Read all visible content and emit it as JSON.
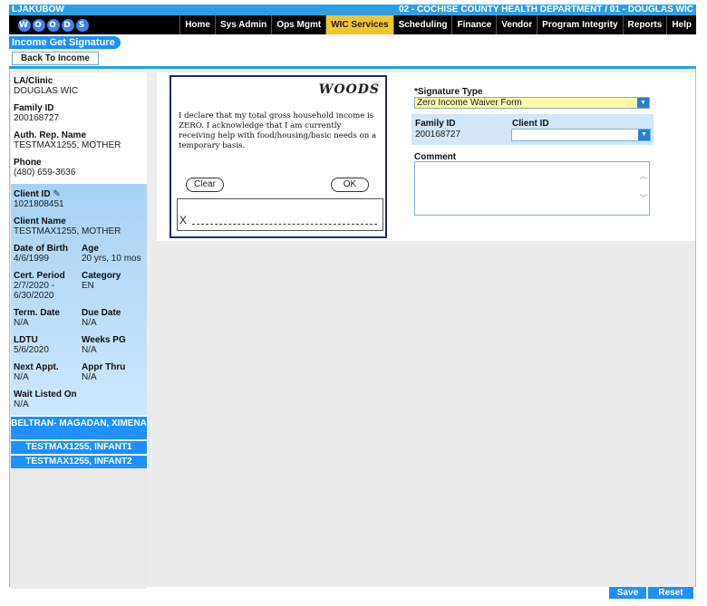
{
  "header": {
    "user": "LJAKUBOW",
    "agency": "02 - COCHISE COUNTY HEALTH DEPARTMENT / 01 - DOUGLAS WIC",
    "logo_text": "WOOD S"
  },
  "menu": [
    "Home",
    "Sys Admin",
    "Ops Mgmt",
    "WIC Services",
    "Scheduling",
    "Finance",
    "Vendor",
    "Program Integrity",
    "Reports",
    "Help"
  ],
  "page": {
    "title": "Income Get Signature",
    "back_label": "Back To Income"
  },
  "sidebar": {
    "la_clinic_label": "LA/Clinic",
    "la_clinic": "DOUGLAS WIC",
    "family_id_label": "Family ID",
    "family_id": "200168727",
    "auth_rep_label": "Auth. Rep. Name",
    "auth_rep": "TESTMAX1255, MOTHER",
    "phone_label": "Phone",
    "phone": "(480) 659-3636",
    "client_id_label": "Client ID",
    "client_id": "1021808451",
    "client_name_label": "Client Name",
    "client_name": "TESTMAX1255, MOTHER",
    "dob_label": "Date of Birth",
    "dob": "4/6/1999",
    "age_label": "Age",
    "age": "20 yrs, 10 mos",
    "cert_label": "Cert. Period",
    "cert_start": "2/7/2020 -",
    "cert_end": "6/30/2020",
    "category_label": "Category",
    "category": "EN",
    "term_label": "Term. Date",
    "term": "N/A",
    "due_label": "Due Date",
    "due": "N/A",
    "ldtu_label": "LDTU",
    "ldtu": "5/6/2020",
    "weeks_label": "Weeks PG",
    "weeks": "N/A",
    "next_label": "Next Appt.",
    "next": "N/A",
    "appr_label": "Appr Thru",
    "appr": "N/A",
    "wait_label": "Wait Listed On",
    "wait": "N/A",
    "children": [
      "BELTRAN- MAGADAN, XIMENA",
      "TESTMAX1255, INFANT1",
      "TESTMAX1255, INFANT2"
    ]
  },
  "signature_pad": {
    "brand": "WOODS",
    "statement": "I declare that my total gross household income is ZERO. I acknowledge that I am currently receiving help with food/housing/basic needs on a temporary basis.",
    "clear_label": "Clear",
    "ok_label": "OK",
    "x_mark": "X"
  },
  "form": {
    "signature_type_label": "*Signature Type",
    "signature_type_value": "Zero Income Waiver Form",
    "family_id_label": "Family ID",
    "family_id_value": "200168727",
    "client_id_label": "Client ID",
    "client_id_value": "",
    "comment_label": "Comment",
    "comment_value": ""
  },
  "footer": {
    "save_label": "Save",
    "reset_label": "Reset"
  }
}
